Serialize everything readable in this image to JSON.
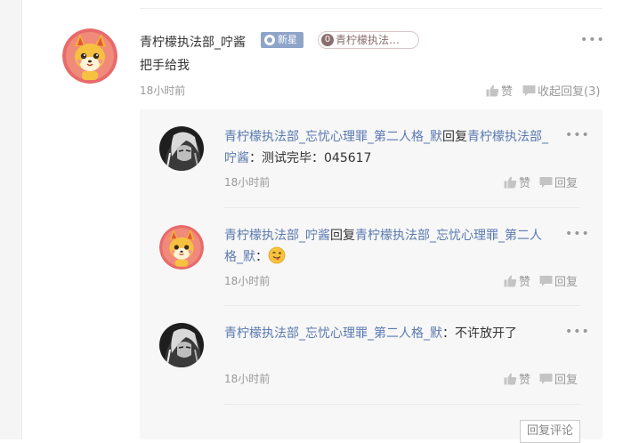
{
  "main_comment": {
    "username": "青柠檬执法部_咛酱",
    "badge_new": "新星",
    "fan_badge_level": "0",
    "fan_badge_name": "青柠檬执法…",
    "text": "把手给我",
    "time": "18小时前",
    "like_label": "赞",
    "collapse_label": "收起回复(3)",
    "more_label": "•••"
  },
  "replies": [
    {
      "avatar": "dark-anime-avatar",
      "author": "青柠檬执法部_忘忧心理罪_第二人格_默",
      "reply_word": "回复",
      "target": "青柠檬执法部_咛酱",
      "colon": "：",
      "content": "测试完毕：045617",
      "time": "18小时前",
      "like_label": "赞",
      "reply_label": "回复",
      "more_label": "•••"
    },
    {
      "avatar": "fox-cartoon-avatar",
      "author": "青柠檬执法部_咛酱",
      "reply_word": "回复",
      "target": "青柠檬执法部_忘忧心理罪_第二人格_默",
      "colon": "：",
      "content": "",
      "emoji": "tongue-wink-emoji",
      "time": "18小时前",
      "like_label": "赞",
      "reply_label": "回复",
      "more_label": "•••"
    },
    {
      "avatar": "dark-anime-avatar",
      "author": "青柠檬执法部_忘忧心理罪_第二人格_默",
      "reply_word": "",
      "target": "",
      "colon": "：",
      "content": "不许放开了",
      "time": "18小时前",
      "like_label": "赞",
      "reply_label": "回复",
      "more_label": "•••"
    }
  ],
  "reply_comment_button": "回复评论",
  "colors": {
    "name_link": "#5a7ab0",
    "muted": "#999999",
    "panel_bg": "#f7f7f7",
    "badge_blue": "#8ea4c8"
  }
}
